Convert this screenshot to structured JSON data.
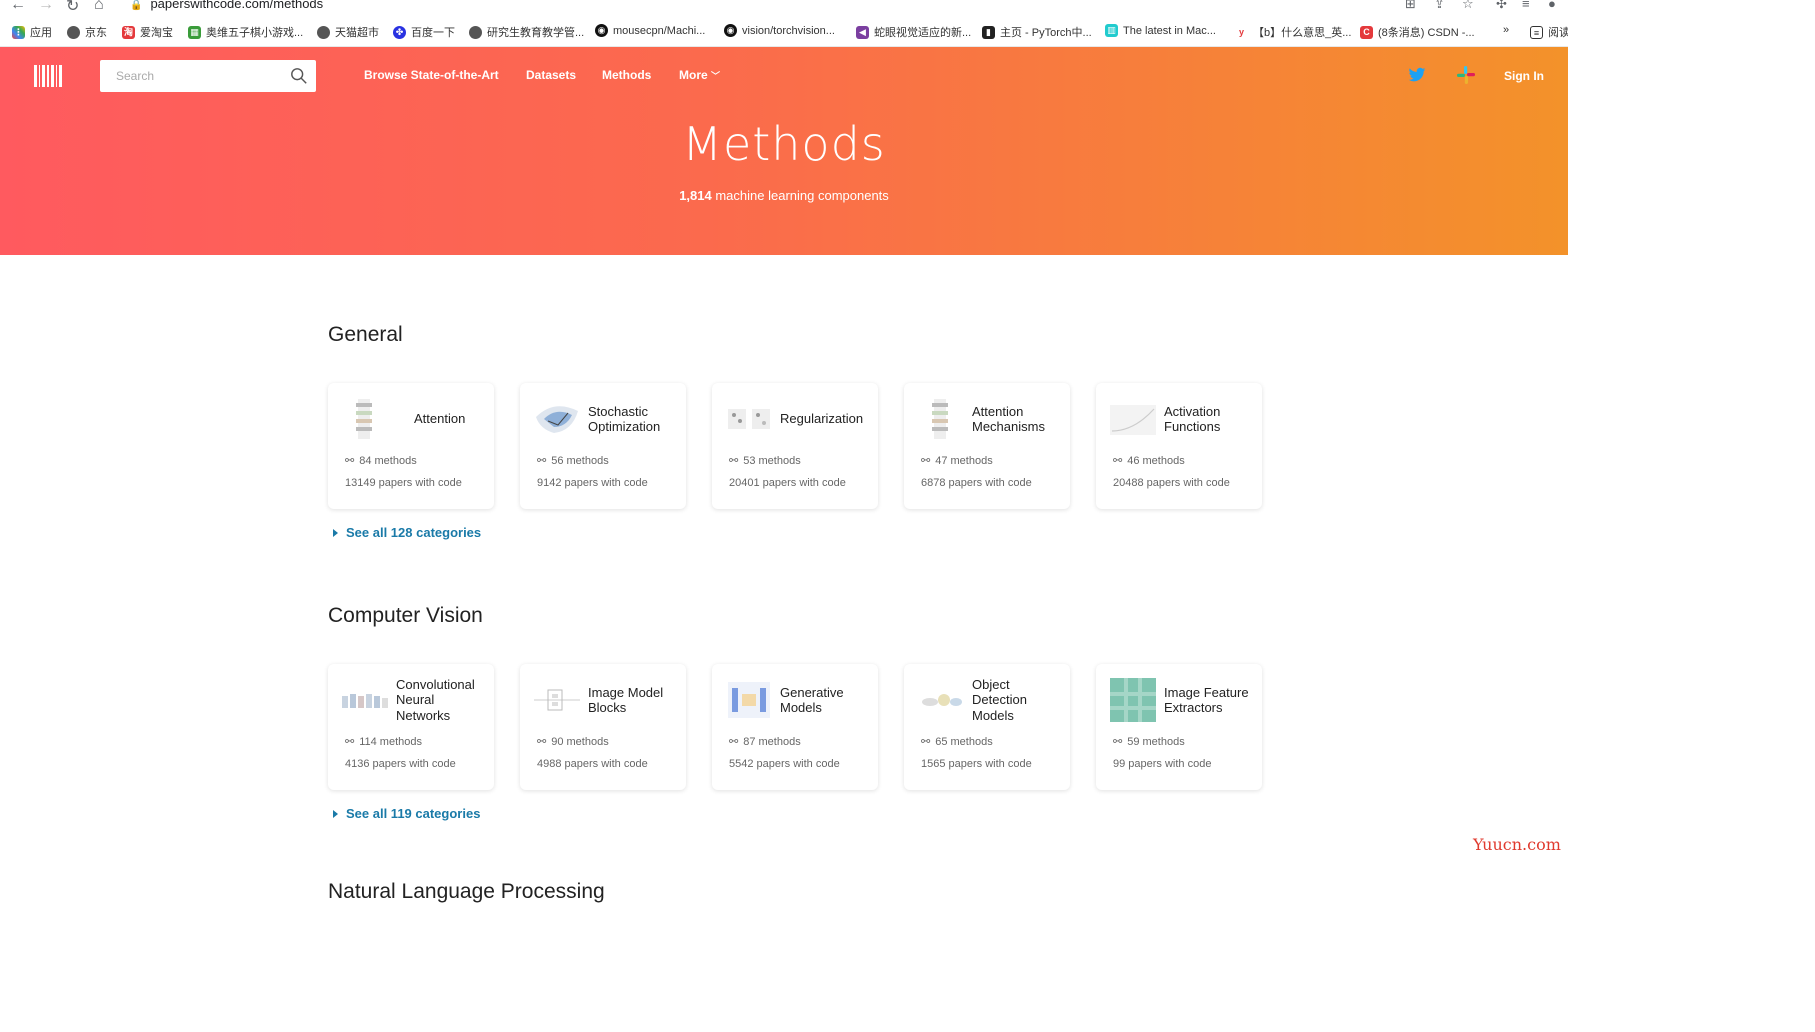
{
  "browser": {
    "url": "paperswithcode.com/methods",
    "bookmarks": [
      "应用",
      "京东",
      "爱淘宝",
      "奥维五子棋小游戏...",
      "天猫超市",
      "百度一下",
      "研究生教育教学管...",
      "mousecpn/Machi...",
      "vision/torchvision...",
      "蛇眼视觉适应的新...",
      "主页 - PyTorch中...",
      "The latest in Mac...",
      "【b】什么意思_英...",
      "(8条消息) CSDN -...",
      "»",
      "阅读"
    ]
  },
  "header": {
    "search_placeholder": "Search",
    "nav": [
      "Browse State-of-the-Art",
      "Datasets",
      "Methods",
      "More"
    ],
    "sign_in": "Sign In",
    "title": "Methods",
    "subtitle_count": "1,814",
    "subtitle_text": " machine learning components"
  },
  "sections": [
    {
      "title": "General",
      "see_all": "See all 128 categories",
      "cards": [
        {
          "name": "Attention",
          "methods": "84 methods",
          "papers": "13149 papers with code"
        },
        {
          "name": "Stochastic Optimization",
          "methods": "56 methods",
          "papers": "9142 papers with code"
        },
        {
          "name": "Regularization",
          "methods": "53 methods",
          "papers": "20401 papers with code"
        },
        {
          "name": "Attention Mechanisms",
          "methods": "47 methods",
          "papers": "6878 papers with code"
        },
        {
          "name": "Activation Functions",
          "methods": "46 methods",
          "papers": "20488 papers with code"
        }
      ]
    },
    {
      "title": "Computer Vision",
      "see_all": "See all 119 categories",
      "cards": [
        {
          "name": "Convolutional Neural Networks",
          "methods": "114 methods",
          "papers": "4136 papers with code"
        },
        {
          "name": "Image Model Blocks",
          "methods": "90 methods",
          "papers": "4988 papers with code"
        },
        {
          "name": "Generative Models",
          "methods": "87 methods",
          "papers": "5542 papers with code"
        },
        {
          "name": "Object Detection Models",
          "methods": "65 methods",
          "papers": "1565 papers with code"
        },
        {
          "name": "Image Feature Extractors",
          "methods": "59 methods",
          "papers": "99 papers with code"
        }
      ]
    },
    {
      "title": "Natural Language Processing"
    }
  ],
  "watermark": "Yuucn.com",
  "colors": {
    "accent": "#1a7aa8",
    "hero_left": "#ff5a5f",
    "hero_right": "#f3922a"
  }
}
